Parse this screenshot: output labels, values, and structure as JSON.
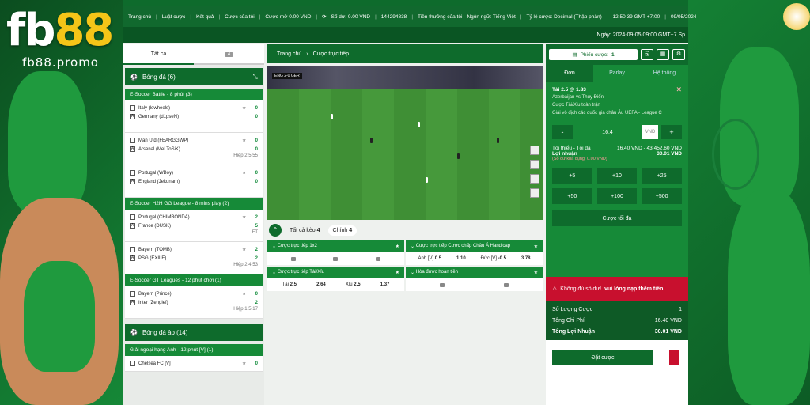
{
  "brand": {
    "logo_a": "fb",
    "logo_b": "88",
    "promo": "fb88.promo"
  },
  "nav": {
    "items": [
      "Trang chủ",
      "Luật cược",
      "Kết quả",
      "Cược của tôi",
      "Cược mở 0.00 VND",
      "Số dư: 0.00 VND",
      "144294838",
      "Tiền thưởng của tôi"
    ],
    "lang": "Ngôn ngữ: Tiếng Việt",
    "odds": "Tỷ lệ cược: Decimal (Thập phân)",
    "time": "12:50:39 GMT +7:00",
    "date": "09/05/2024"
  },
  "datebar": "Ngày: 2024-09-05 09:00 GMT+7 Sp",
  "left": {
    "tab_all": "Tất cả",
    "tab_count": "4",
    "sport1": "Bóng đá (6)",
    "leagues": [
      {
        "name": "E-Soccer Battle - 8 phút (3)",
        "matches": [
          {
            "h": "Italy (lowheels)",
            "a": "Germany (d1pseN)",
            "hs": "0",
            "as": "0",
            "meta": ""
          },
          {
            "h": "Man Utd (FEARGGWP)",
            "a": "Arsenal (MeLToSiK)",
            "hs": "0",
            "as": "0",
            "meta": "Hiệp 2 5:55"
          },
          {
            "h": "Portugal (WBoy)",
            "a": "England (Jekunam)",
            "hs": "0",
            "as": "0",
            "meta": ""
          }
        ]
      },
      {
        "name": "E-Soccer H2H GG League - 8 mins play (2)",
        "matches": [
          {
            "h": "Portugal (CHIMBONDA)",
            "a": "France (DUSK)",
            "hs": "2",
            "as": "5",
            "meta": "FT"
          },
          {
            "h": "Bayern (TOMB)",
            "a": "PSG (EXILE)",
            "hs": "2",
            "as": "2",
            "meta": "Hiệp 2 4:53"
          }
        ]
      },
      {
        "name": "E-Soccer GT Leagues - 12 phút chơi (1)",
        "matches": [
          {
            "h": "Bayern (Prince)",
            "a": "Inter (Zenglef)",
            "hs": "0",
            "as": "2",
            "meta": "Hiệp 1 5:17"
          }
        ]
      }
    ],
    "sport2": "Bóng đá ảo (14)",
    "league2": "Giải ngoại hạng Anh - 12 phút [V] (1)",
    "match2": "Chelsea FC [V]"
  },
  "center": {
    "crumb_home": "Trang chủ",
    "crumb_sep": "›",
    "crumb_cur": "Cược trực tiếp",
    "scoreboard": "ENG 2-0 GER",
    "tab_all": "Tất cả kèo",
    "tab_all_n": "4",
    "tab_main": "Chính",
    "tab_main_n": "4",
    "m1": "Cược trực tiếp 1x2",
    "m2": "Cược trực tiếp Cược chấp Châu Á Handicap",
    "hc": {
      "a": "Anh [V]",
      "av": "0.5",
      "ao": "1.10",
      "b": "Đức [V]",
      "bv": "-0.5",
      "bo": "3.78"
    },
    "m3": "Cược trực tiếp Tài/Xỉu",
    "m4": "Hòa được hoàn tiền",
    "ou": {
      "a": "Tài",
      "av": "2.5",
      "ao": "2.64",
      "b": "Xỉu",
      "bv": "2.5",
      "bo": "1.37"
    }
  },
  "right": {
    "slip": "Phiếu cược:",
    "slip_n": "1",
    "tab_single": "Đơn",
    "tab_parlay": "Parlay",
    "tab_system": "Hệ thống",
    "sel": "Tài 2.5 @ 1.83",
    "event": "Azerbaijan vs Thụy Điển",
    "market": "Cược Tài/Xỉu toàn trận",
    "league": "Giải vô địch các quốc gia châu Âu UEFA - League C",
    "stake": "16.4",
    "cur": "VND",
    "minmax_l": "Tối thiểu - Tối đa",
    "minmax_v": "16.40 VND - 43,452.60 VND",
    "profit_l": "Lợi nhuận",
    "profit_v": "30.01 VND",
    "avail": "(Số dư khả dụng: 0.00 VND)",
    "quick": [
      "+5",
      "+10",
      "+25",
      "+50",
      "+100",
      "+500"
    ],
    "max": "Cược tối đa",
    "warn": "Không đủ số dư!",
    "warn_b": "vui lòng nạp thêm tiền.",
    "sum": [
      {
        "l": "Số Lượng Cược",
        "v": "1"
      },
      {
        "l": "Tổng Chi Phí",
        "v": "16.40 VND"
      },
      {
        "l": "Tổng Lợi Nhuận",
        "v": "30.01 VND"
      }
    ],
    "place": "Đặt cược"
  }
}
